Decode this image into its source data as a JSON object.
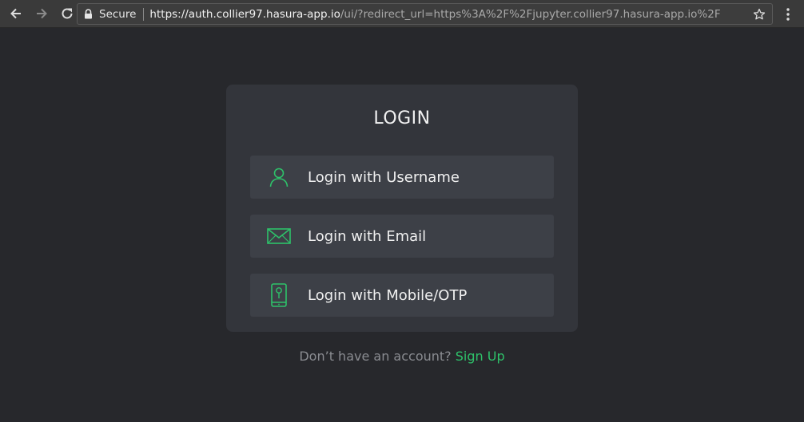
{
  "browser": {
    "secure_label": "Secure",
    "url_host": "https://auth.collier97.hasura-app.io",
    "url_rest": "/ui/?redirect_url=https%3A%2F%2Fjupyter.collier97.hasura-app.io%2F"
  },
  "login": {
    "title": "LOGIN",
    "options": [
      {
        "label": "Login with Username",
        "icon": "user-icon"
      },
      {
        "label": "Login with Email",
        "icon": "envelope-icon"
      },
      {
        "label": "Login with Mobile/OTP",
        "icon": "mobile-icon"
      }
    ]
  },
  "signup": {
    "prompt": "Don’t have an account?",
    "link": "Sign Up"
  },
  "colors": {
    "accent": "#2ec26a",
    "page_bg": "#27282c",
    "card_bg": "#33353b",
    "option_bg": "#3d4047"
  }
}
